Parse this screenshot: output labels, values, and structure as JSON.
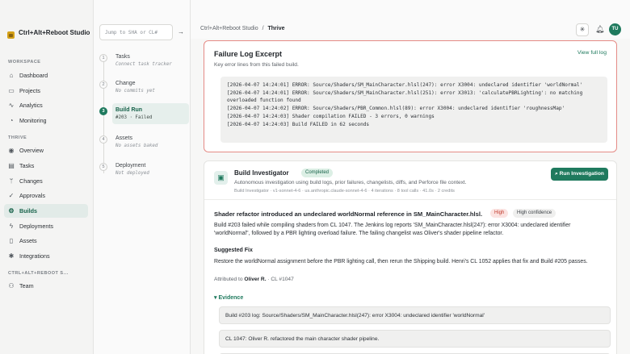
{
  "brand": {
    "name": "Ctrl+Alt+Reboot Studio"
  },
  "sidebar": {
    "workspace_label": "WORKSPACE",
    "workspace_items": [
      {
        "label": "Dashboard",
        "icon": "home-icon"
      },
      {
        "label": "Projects",
        "icon": "folder-icon"
      },
      {
        "label": "Analytics",
        "icon": "activity-icon"
      },
      {
        "label": "Monitoring",
        "icon": "bell-icon"
      }
    ],
    "project_label": "THRIVE",
    "project_items": [
      {
        "label": "Overview",
        "icon": "eye-icon"
      },
      {
        "label": "Tasks",
        "icon": "clipboard-icon"
      },
      {
        "label": "Changes",
        "icon": "branch-icon"
      },
      {
        "label": "Approvals",
        "icon": "check-icon"
      },
      {
        "label": "Builds",
        "icon": "build-icon",
        "active": true
      },
      {
        "label": "Deployments",
        "icon": "bolt-icon"
      },
      {
        "label": "Assets",
        "icon": "file-icon"
      },
      {
        "label": "Integrations",
        "icon": "gear-icon"
      }
    ],
    "team_section_label": "CTRL+ALT+REBOOT S...",
    "team_items": [
      {
        "label": "Team",
        "icon": "users-icon"
      }
    ]
  },
  "timeline": {
    "search_placeholder": "Jump to SHA or CL#",
    "steps": [
      {
        "num": "1",
        "title": "Tasks",
        "sub": "Connect task tracker"
      },
      {
        "num": "2",
        "title": "Change",
        "sub": "No commits yet"
      },
      {
        "num": "3",
        "title": "Build Run",
        "sub": "#203 · Failed",
        "active": true
      },
      {
        "num": "4",
        "title": "Assets",
        "sub": "No assets baked"
      },
      {
        "num": "5",
        "title": "Deployment",
        "sub": "Not deployed"
      }
    ]
  },
  "topbar": {
    "crumb_root": "Ctrl+Alt+Reboot Studio",
    "crumb_sep": "/",
    "crumb_current": "Thrive",
    "avatar_initials": "TU"
  },
  "failure": {
    "title": "Failure Log Excerpt",
    "subtitle": "Key error lines from this failed build.",
    "link": "View full log",
    "log": "[2026-04-07 14:24:01] ERROR: Source/Shaders/SM_MainCharacter.hlsl(247): error X3004: undeclared identifier 'worldNormal'\n[2026-04-07 14:24:01] ERROR: Source/Shaders/SM_MainCharacter.hlsl(251): error X3013: 'calculatePBRLighting': no matching overloaded function found\n[2026-04-07 14:24:02] ERROR: Source/Shaders/PBR_Common.hlsl(89): error X3004: undeclared identifier 'roughnessMap'\n[2026-04-07 14:24:03] Shader compilation FAILED - 3 errors, 0 warnings\n[2026-04-07 14:24:03] Build FAILED in 62 seconds"
  },
  "investigator": {
    "title": "Build Investigator",
    "status": "Completed",
    "description": "Autonomous investigation using build logs, prior failures, changelists, diffs, and Perforce file context.",
    "meta": "Build Investigator · v1-sonnet-4-6 · us.anthropic.claude-sonnet-4-6 · 4 iterations · 8 tool calls · 41.0s · 2 credits",
    "run_button": "Run Investigation",
    "finding_title": "Shader refactor introduced an undeclared worldNormal reference in SM_MainCharacter.hlsl.",
    "severity": "High",
    "confidence": "High confidence",
    "finding_text": "Build #203 failed while compiling shaders from CL 1047. The Jenkins log reports 'SM_MainCharacter.hlsl(247): error X3004: undeclared identifier 'worldNormal'', followed by a PBR lighting overload failure. The failing changelist was Oliver's shader pipeline refactor.",
    "fix_title": "Suggested Fix",
    "fix_text": "Restore the worldNormal assignment before the PBR lighting call, then rerun the Shipping build. Henri's CL 1052 applies that fix and Build #205 passes.",
    "attributed_prefix": "Attributed to",
    "attributed_name": "Oliver R.",
    "attributed_cl": "· CL #1047",
    "evidence_title": "Evidence",
    "evidence": [
      "Build #203 log: Source/Shaders/SM_MainCharacter.hlsl(247): error X3004: undeclared identifier 'worldNormal'",
      "CL 1047: Oliver R. refactored the main character shader pipeline.",
      ""
    ]
  },
  "colors": {
    "accent": "#1f7a5e",
    "error_border": "#e58b86",
    "brand": "#d4a017"
  }
}
